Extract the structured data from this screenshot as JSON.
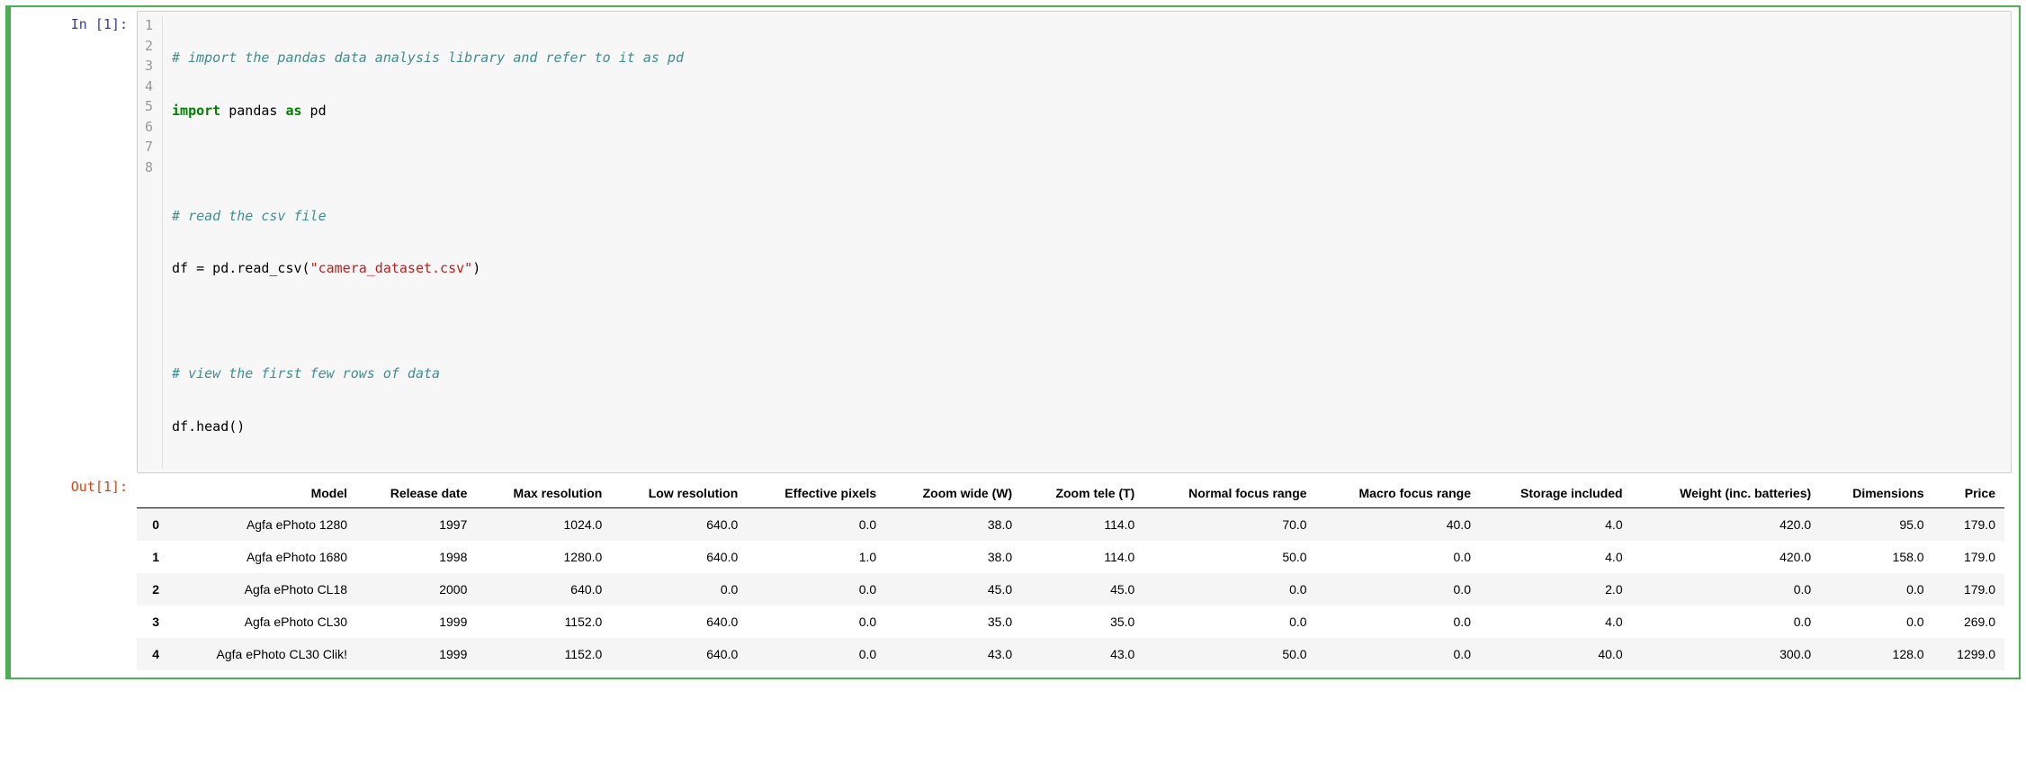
{
  "in_prompt": "In [1]:",
  "out_prompt": "Out[1]:",
  "gutter": [
    "1",
    "2",
    "3",
    "4",
    "5",
    "6",
    "7",
    "8"
  ],
  "code": {
    "l1": "# import the pandas data analysis library and refer to it as pd",
    "l2a": "import",
    "l2b": " pandas ",
    "l2c": "as",
    "l2d": " pd",
    "l3": "",
    "l4": "# read the csv file",
    "l5a": "df = pd.read_csv(",
    "l5b": "\"camera_dataset.csv\"",
    "l5c": ")",
    "l6": "",
    "l7": "# view the first few rows of data",
    "l8": "df.head()"
  },
  "columns": [
    "Model",
    "Release date",
    "Max resolution",
    "Low resolution",
    "Effective pixels",
    "Zoom wide (W)",
    "Zoom tele (T)",
    "Normal focus range",
    "Macro focus range",
    "Storage included",
    "Weight (inc. batteries)",
    "Dimensions",
    "Price"
  ],
  "index": [
    "0",
    "1",
    "2",
    "3",
    "4"
  ],
  "rows": [
    [
      "Agfa ePhoto 1280",
      "1997",
      "1024.0",
      "640.0",
      "0.0",
      "38.0",
      "114.0",
      "70.0",
      "40.0",
      "4.0",
      "420.0",
      "95.0",
      "179.0"
    ],
    [
      "Agfa ePhoto 1680",
      "1998",
      "1280.0",
      "640.0",
      "1.0",
      "38.0",
      "114.0",
      "50.0",
      "0.0",
      "4.0",
      "420.0",
      "158.0",
      "179.0"
    ],
    [
      "Agfa ePhoto CL18",
      "2000",
      "640.0",
      "0.0",
      "0.0",
      "45.0",
      "45.0",
      "0.0",
      "0.0",
      "2.0",
      "0.0",
      "0.0",
      "179.0"
    ],
    [
      "Agfa ePhoto CL30",
      "1999",
      "1152.0",
      "640.0",
      "0.0",
      "35.0",
      "35.0",
      "0.0",
      "0.0",
      "4.0",
      "0.0",
      "0.0",
      "269.0"
    ],
    [
      "Agfa ePhoto CL30 Clik!",
      "1999",
      "1152.0",
      "640.0",
      "0.0",
      "43.0",
      "43.0",
      "50.0",
      "0.0",
      "40.0",
      "300.0",
      "128.0",
      "1299.0"
    ]
  ]
}
